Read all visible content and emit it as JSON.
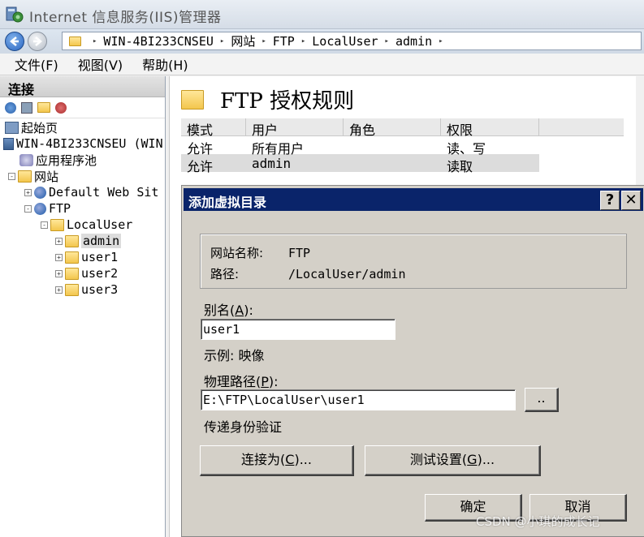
{
  "window": {
    "title": "Internet 信息服务(IIS)管理器",
    "app_icon": "iis-manager-icon"
  },
  "address": {
    "segments": [
      "WIN-4BI233CNSEU",
      "网站",
      "FTP",
      "LocalUser",
      "admin"
    ],
    "separator": "▸"
  },
  "menu": {
    "file": "文件(F)",
    "view": "视图(V)",
    "help": "帮助(H)"
  },
  "connections": {
    "header": "连接",
    "tree": [
      {
        "label": "起始页",
        "icon": "start-page-icon"
      },
      {
        "label": "WIN-4BI233CNSEU (WIN",
        "icon": "server-icon",
        "expander": "-"
      },
      {
        "label": "应用程序池",
        "icon": "app-pool-icon"
      },
      {
        "label": "网站",
        "icon": "sites-icon",
        "expander": "-"
      },
      {
        "label": "Default Web Sit",
        "icon": "globe-icon",
        "expander": "+"
      },
      {
        "label": "FTP",
        "icon": "globe-icon",
        "expander": "-"
      },
      {
        "label": "LocalUser",
        "icon": "folder-icon",
        "expander": "-"
      },
      {
        "label": "admin",
        "icon": "folder-icon",
        "expander": "+",
        "selected": true
      },
      {
        "label": "user1",
        "icon": "folder-icon",
        "expander": "+"
      },
      {
        "label": "user2",
        "icon": "folder-icon",
        "expander": "+"
      },
      {
        "label": "user3",
        "icon": "folder-icon",
        "expander": "+"
      }
    ]
  },
  "main": {
    "title": "FTP 授权规则",
    "columns": [
      "模式",
      "用户",
      "角色",
      "权限"
    ],
    "rows": [
      [
        "允许",
        "所有用户",
        "",
        "读、写"
      ],
      [
        "允许",
        "admin",
        "",
        "读取"
      ]
    ]
  },
  "dialog": {
    "title": "添加虚拟目录",
    "help_button": "?",
    "close_button": "✕",
    "site_name_label": "网站名称:",
    "site_name_value": "FTP",
    "path_label": "路径:",
    "path_value": "/LocalUser/admin",
    "alias_label_main": "别名(",
    "alias_label_key": "A",
    "alias_label_end": "):",
    "alias_value": "user1",
    "example": "示例: 映像",
    "physical_label_main": "物理路径(",
    "physical_label_key": "P",
    "physical_label_end": "):",
    "physical_value": "E:\\FTP\\LocalUser\\user1",
    "browse_button": "..",
    "passthrough": "传递身份验证",
    "connect_as_main": "连接为(",
    "connect_as_key": "C",
    "connect_as_end": ")...",
    "test_settings_main": "测试设置(",
    "test_settings_key": "G",
    "test_settings_end": ")...",
    "ok": "确定",
    "cancel": "取消"
  },
  "watermark": "CSDN @小琪的成长记"
}
